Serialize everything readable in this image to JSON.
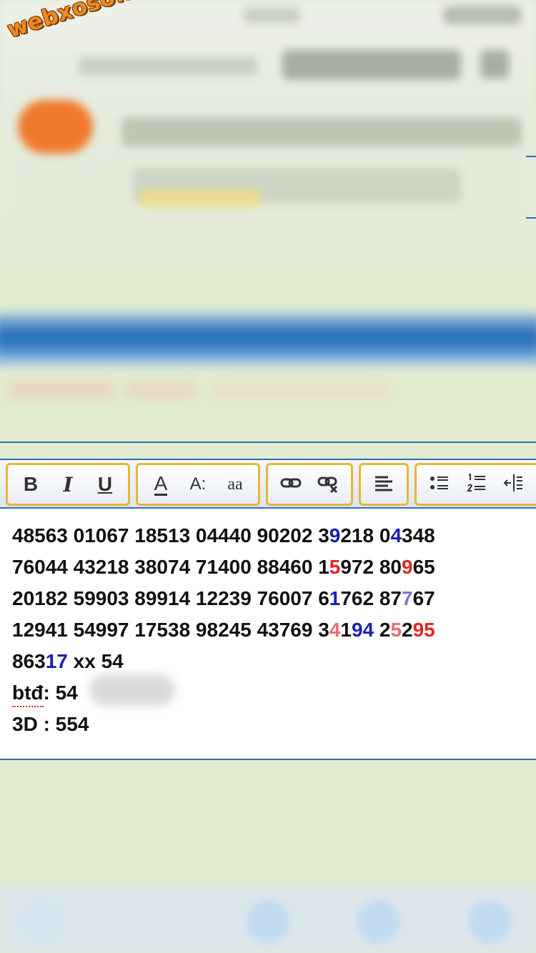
{
  "watermark": {
    "text": "webxoso.net"
  },
  "toolbar": {
    "groups": [
      {
        "name": "text-style",
        "buttons": [
          {
            "name": "bold-button",
            "glyph": "B"
          },
          {
            "name": "italic-button",
            "glyph": "I"
          },
          {
            "name": "underline-button",
            "glyph": "U"
          }
        ]
      },
      {
        "name": "font",
        "buttons": [
          {
            "name": "font-color-button",
            "glyph": "A"
          },
          {
            "name": "font-size-button",
            "glyph": "A:"
          },
          {
            "name": "font-case-button",
            "glyph": "aa"
          }
        ]
      },
      {
        "name": "links",
        "buttons": [
          {
            "name": "insert-link-button",
            "icon": "link-icon"
          },
          {
            "name": "remove-link-button",
            "icon": "unlink-icon"
          }
        ]
      },
      {
        "name": "alignment",
        "buttons": [
          {
            "name": "align-left-button",
            "icon": "align-left-icon"
          }
        ]
      },
      {
        "name": "lists",
        "buttons": [
          {
            "name": "bullet-list-button",
            "icon": "bullet-list-icon"
          },
          {
            "name": "numbered-list-button",
            "icon": "numbered-list-icon"
          },
          {
            "name": "outdent-button",
            "icon": "outdent-icon"
          },
          {
            "name": "indent-button",
            "icon": "indent-icon"
          }
        ]
      }
    ]
  },
  "editor": {
    "line1": {
      "a": "48563 01067 18513 04440 90202 3",
      "b": "9",
      "c": "218 0",
      "d": "4",
      "e": "348"
    },
    "line2": {
      "a": "76044 43218 38074 71400 88460 1",
      "b": "5",
      "c": "972 80",
      "d": "9",
      "e": "65"
    },
    "line3": {
      "a": "20182 59903 89914 12239 76007 6",
      "b": "1",
      "c": "762 87",
      "d": "7",
      "e": "67"
    },
    "line4": {
      "a": "12941 54997 17538 98245 43769 3",
      "b": "4",
      "c": "1",
      "d": "94",
      "e": " 2",
      "f": "5",
      "g": "2",
      "h": "95"
    },
    "line5": {
      "a": "863",
      "b": "17",
      "c": " xx 54"
    },
    "line6": {
      "label": "btđ",
      "rest": ": 54"
    },
    "line7": {
      "text": "3D : 554"
    }
  },
  "colors": {
    "background": "#e1ecd0",
    "toolbar_border": "#e6b637",
    "rule": "#2e6fae",
    "highlight_blue": "#1a1fb5",
    "highlight_red": "#e0262a",
    "watermark": "#f08a1c"
  }
}
